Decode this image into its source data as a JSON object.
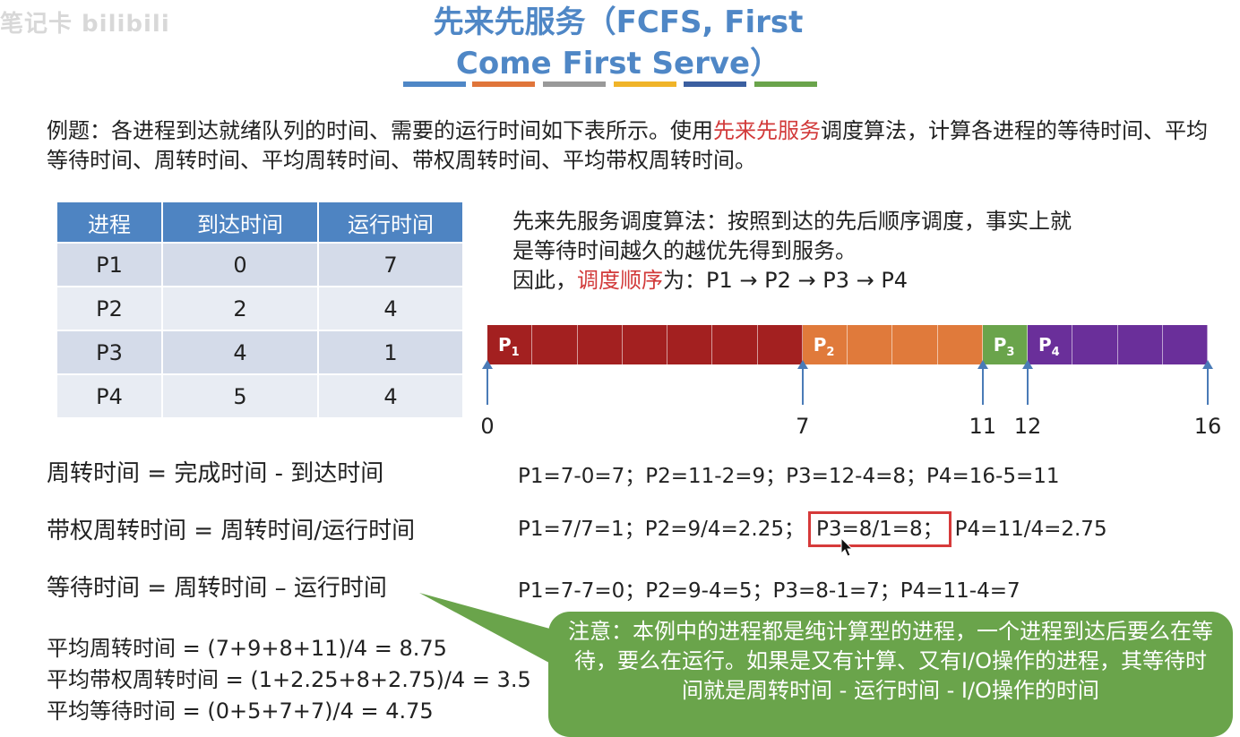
{
  "watermark": "笔记卡 bilibili",
  "title": {
    "line1": "先来先服务（FCFS, First",
    "line2": "Come First Serve）"
  },
  "accent_bars": [
    "#4f87c6",
    "#e0753a",
    "#999999",
    "#f0b429",
    "#3b5fa0",
    "#6aa44b"
  ],
  "question": {
    "prefix": "例题：各进程到达就绪队列的时间、需要的运行时间如下表所示。使用",
    "highlight": "先来先服务",
    "suffix": "调度算法，计算各进程的等待时间、平均等待时间、周转时间、平均周转时间、带权周转时间、平均带权周转时间。"
  },
  "table": {
    "headers": [
      "进程",
      "到达时间",
      "运行时间"
    ],
    "rows": [
      [
        "P1",
        "0",
        "7"
      ],
      [
        "P2",
        "2",
        "4"
      ],
      [
        "P3",
        "4",
        "1"
      ],
      [
        "P4",
        "5",
        "4"
      ]
    ]
  },
  "description": {
    "line1": "先来先服务调度算法：按照到达的先后顺序调度，事实上就",
    "line2": "是等待时间越久的越优先得到服务。",
    "line3_prefix": "因此，",
    "line3_highlight": "调度顺序",
    "line3_suffix": "为：P1 → P2 → P3 → P4"
  },
  "gantt": {
    "segments": [
      {
        "name": "P",
        "sub": "1",
        "start": 0,
        "end": 7,
        "color": "#a32020"
      },
      {
        "name": "P",
        "sub": "2",
        "start": 7,
        "end": 11,
        "color": "#e07a3b"
      },
      {
        "name": "P",
        "sub": "3",
        "start": 11,
        "end": 12,
        "color": "#6aa44b"
      },
      {
        "name": "P",
        "sub": "4",
        "start": 12,
        "end": 16,
        "color": "#6a2f9a"
      }
    ],
    "ticks": [
      "0",
      "7",
      "11",
      "12",
      "16"
    ],
    "total": 16
  },
  "formulas": {
    "turnaround": "周转时间 = 完成时间 - 到达时间",
    "weighted": "带权周转时间 = 周转时间/运行时间",
    "waiting": "等待时间 = 周转时间 – 运行时间"
  },
  "calcs": {
    "turnaround": "P1=7-0=7；P2=11-2=9；P3=12-4=8；P4=16-5=11",
    "weighted_a": "P1=7/7=1；P2=9/4=2.25；",
    "weighted_box": "P3=8/1=8；",
    "weighted_b": "P4=11/4=2.75",
    "waiting": "P1=7-7=0；P2=9-4=5；P3=8-1=7；P4=11-4=7"
  },
  "averages": {
    "turnaround": "平均周转时间 = (7+9+8+11)/4 = 8.75",
    "weighted": "平均带权周转时间 = (1+2.25+8+2.75)/4 = 3.5",
    "waiting": "平均等待时间 = (0+5+7+7)/4 = 4.75"
  },
  "note": "注意：本例中的进程都是纯计算型的进程，一个进程到达后要么在等待，要么在运行。如果是又有计算、又有I/O操作的进程，其等待时间就是周转时间 - 运行时间 - I/O操作的时间"
}
